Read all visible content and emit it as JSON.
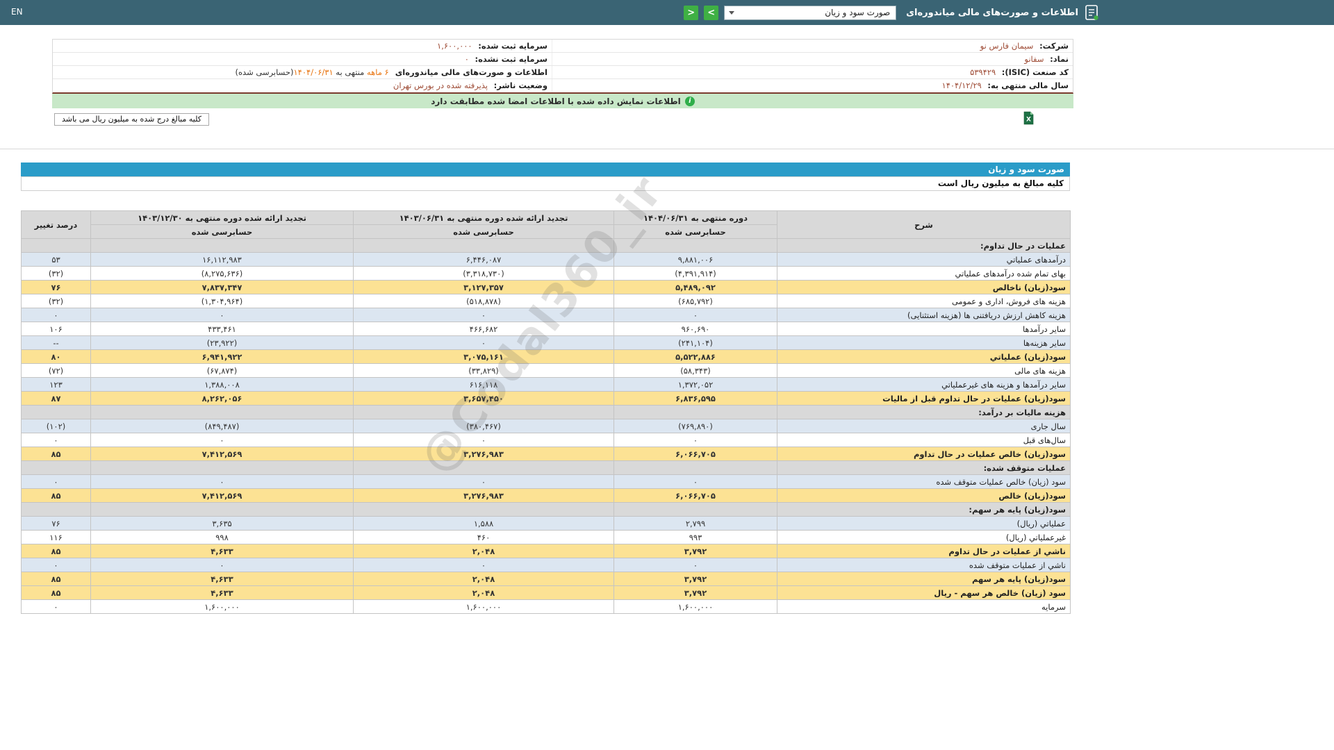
{
  "colors": {
    "topbar": "#3a6474",
    "accent_green": "#3fb044",
    "title_blue": "#2a9cc8",
    "row_yellow": "#fce294",
    "row_blue": "#dce6f1",
    "section_gray": "#d9d9d9",
    "negative_red": "#e53935",
    "value_maroon": "#9e4b35",
    "highlight_orange": "#e8730e",
    "banner_green": "#c8e8c8"
  },
  "header": {
    "title": "اطلاعات و صورت‌های مالی میاندوره‌ای",
    "report_select": "صورت سود و زیان",
    "next_glyph": ">",
    "prev_glyph": "<",
    "lang": "EN"
  },
  "company": {
    "right": [
      {
        "label": "شرکت:",
        "value": "سیمان فارس نو"
      },
      {
        "label": "نماد:",
        "value": "سفانو"
      },
      {
        "label": "کد صنعت (ISIC):",
        "value": "۵۳۹۴۲۹"
      },
      {
        "label": "سال مالی منتهی به:",
        "value": "۱۴۰۴/۱۲/۲۹"
      }
    ],
    "left": [
      {
        "label": "سرمایه ثبت شده:",
        "value": "۱,۶۰۰,۰۰۰"
      },
      {
        "label": "سرمایه ثبت نشده:",
        "value": "۰"
      },
      {
        "p1": "اطلاعات و صورت‌های مالی میاندوره‌ای ",
        "p2": "۶ ماهه",
        "p3": " منتهی به ",
        "p4": "۱۴۰۴/۰۶/۳۱",
        "p5": "(حسابرسی شده)"
      },
      {
        "label": "وضعیت ناشر:",
        "value": "پذیرفته شده در بورس تهران"
      }
    ]
  },
  "banner": {
    "icon_text": "i",
    "text": "اطلاعات نمایش داده شده با اطلاعات امضا شده مطابقت دارد"
  },
  "note": {
    "text": "کلیه مبالغ درج شده به میلیون ریال می باشد"
  },
  "statement": {
    "title": "صورت سود و زیان",
    "unit_note": "کلیه مبالغ به میلیون ریال است"
  },
  "watermark": "@Codal360_ir",
  "table": {
    "headers": {
      "desc": "شرح",
      "p1": "دوره منتهی به ۱۴۰۴/۰۶/۳۱",
      "p2": "تجدید ارائه شده دوره منتهی به ۱۴۰۳/۰۶/۳۱",
      "p3": "تجدید ارائه شده دوره منتهی به ۱۴۰۳/۱۲/۳۰",
      "audited": "حسابرسی شده",
      "pct": "درصد تغییر"
    },
    "rows": [
      {
        "type": "section",
        "label": "عملیات در حال تداوم:"
      },
      {
        "bg": "blue",
        "label": "درآمدهای عملیاتي",
        "v1": "۹,۸۸۱,۰۰۶",
        "v2": "۶,۴۴۶,۰۸۷",
        "v3": "۱۶,۱۱۲,۹۸۳",
        "pct": "۵۳"
      },
      {
        "bg": "white",
        "label": "بهای تمام شده درآمدهای عملیاتي",
        "v1": "(۴,۳۹۱,۹۱۴)",
        "v2": "(۳,۳۱۸,۷۳۰)",
        "v3": "(۸,۲۷۵,۶۳۶)",
        "pct": "(۳۲)"
      },
      {
        "bg": "yellow",
        "label": "سود(زیان) ناخالص",
        "v1": "۵,۴۸۹,۰۹۲",
        "v2": "۳,۱۲۷,۳۵۷",
        "v3": "۷,۸۳۷,۳۴۷",
        "pct": "۷۶"
      },
      {
        "bg": "white",
        "label": "هزینه های فروش، اداری و عمومی",
        "v1": "(۶۸۵,۷۹۲)",
        "v2": "(۵۱۸,۸۷۸)",
        "v3": "(۱,۳۰۴,۹۶۴)",
        "pct": "(۳۲)"
      },
      {
        "bg": "blue",
        "label": "هزینه کاهش ارزش دریافتنی ها (هزینه استثنایی)",
        "v1": "۰",
        "v2": "۰",
        "v3": "۰",
        "pct": "۰"
      },
      {
        "bg": "white",
        "label": "سایر درآمدها",
        "v1": "۹۶۰,۶۹۰",
        "v2": "۴۶۶,۶۸۲",
        "v3": "۴۳۳,۴۶۱",
        "pct": "۱۰۶"
      },
      {
        "bg": "blue",
        "label": "سایر هزینه‌ها",
        "v1": "(۲۴۱,۱۰۴)",
        "v2": "۰",
        "v3": "(۲۳,۹۲۲)",
        "pct": "--"
      },
      {
        "bg": "yellow",
        "label": "سود(زیان) عملیاتي",
        "v1": "۵,۵۲۲,۸۸۶",
        "v2": "۳,۰۷۵,۱۶۱",
        "v3": "۶,۹۴۱,۹۲۲",
        "pct": "۸۰"
      },
      {
        "bg": "white",
        "label": "هزینه های مالی",
        "v1": "(۵۸,۳۴۳)",
        "v2": "(۳۳,۸۲۹)",
        "v3": "(۶۷,۸۷۴)",
        "pct": "(۷۲)"
      },
      {
        "bg": "blue",
        "label": "سایر درآمدها و هزینه های غیرعملیاتي",
        "v1": "۱,۳۷۲,۰۵۲",
        "v2": "۶۱۶,۱۱۸",
        "v3": "۱,۳۸۸,۰۰۸",
        "pct": "۱۲۳"
      },
      {
        "bg": "yellow",
        "label": "سود(زیان) عملیات در حال تداوم قبل از مالیات",
        "v1": "۶,۸۳۶,۵۹۵",
        "v2": "۳,۶۵۷,۴۵۰",
        "v3": "۸,۲۶۲,۰۵۶",
        "pct": "۸۷"
      },
      {
        "type": "section",
        "label": "هزینه مالیات بر درآمد:"
      },
      {
        "bg": "blue",
        "label": "سال جاری",
        "v1": "(۷۶۹,۸۹۰)",
        "v2": "(۳۸۰,۴۶۷)",
        "v3": "(۸۴۹,۴۸۷)",
        "pct": "(۱۰۲)"
      },
      {
        "bg": "white",
        "label": "سال‌های قبل",
        "v1": "۰",
        "v2": "۰",
        "v3": "۰",
        "pct": "۰"
      },
      {
        "bg": "yellow",
        "label": "سود(زیان) خالص عملیات در حال تداوم",
        "v1": "۶,۰۶۶,۷۰۵",
        "v2": "۳,۲۷۶,۹۸۳",
        "v3": "۷,۴۱۲,۵۶۹",
        "pct": "۸۵"
      },
      {
        "type": "section",
        "label": "عملیات متوقف شده:"
      },
      {
        "bg": "blue",
        "label": "سود (زیان) خالص عملیات متوقف شده",
        "v1": "۰",
        "v2": "۰",
        "v3": "۰",
        "pct": "۰"
      },
      {
        "bg": "yellow",
        "label": "سود(زیان) خالص",
        "v1": "۶,۰۶۶,۷۰۵",
        "v2": "۳,۲۷۶,۹۸۳",
        "v3": "۷,۴۱۲,۵۶۹",
        "pct": "۸۵"
      },
      {
        "type": "section",
        "label": "سود(زیان) پایه هر سهم:"
      },
      {
        "bg": "blue",
        "label": "عملیاتي (ریال)",
        "v1": "۲,۷۹۹",
        "v2": "۱,۵۸۸",
        "v3": "۳,۶۳۵",
        "pct": "۷۶"
      },
      {
        "bg": "white",
        "label": "غیرعملیاتي (ریال)",
        "v1": "۹۹۳",
        "v2": "۴۶۰",
        "v3": "۹۹۸",
        "pct": "۱۱۶"
      },
      {
        "bg": "yellow",
        "label": "ناشي از عملیات در حال تداوم",
        "v1": "۳,۷۹۲",
        "v2": "۲,۰۴۸",
        "v3": "۴,۶۳۳",
        "pct": "۸۵"
      },
      {
        "bg": "blue",
        "label": "ناشي از عملیات متوقف شده",
        "v1": "۰",
        "v2": "۰",
        "v3": "۰",
        "pct": "۰"
      },
      {
        "bg": "yellow",
        "label": "سود(زیان) پایه هر سهم",
        "v1": "۳,۷۹۲",
        "v2": "۲,۰۴۸",
        "v3": "۴,۶۳۳",
        "pct": "۸۵"
      },
      {
        "bg": "yellow",
        "label": "سود (زیان) خالص هر سهم - ریال",
        "v1": "۳,۷۹۲",
        "v2": "۲,۰۴۸",
        "v3": "۴,۶۳۳",
        "pct": "۸۵"
      },
      {
        "bg": "white",
        "label": "سرمایه",
        "v1": "۱,۶۰۰,۰۰۰",
        "v2": "۱,۶۰۰,۰۰۰",
        "v3": "۱,۶۰۰,۰۰۰",
        "pct": "۰"
      }
    ]
  }
}
